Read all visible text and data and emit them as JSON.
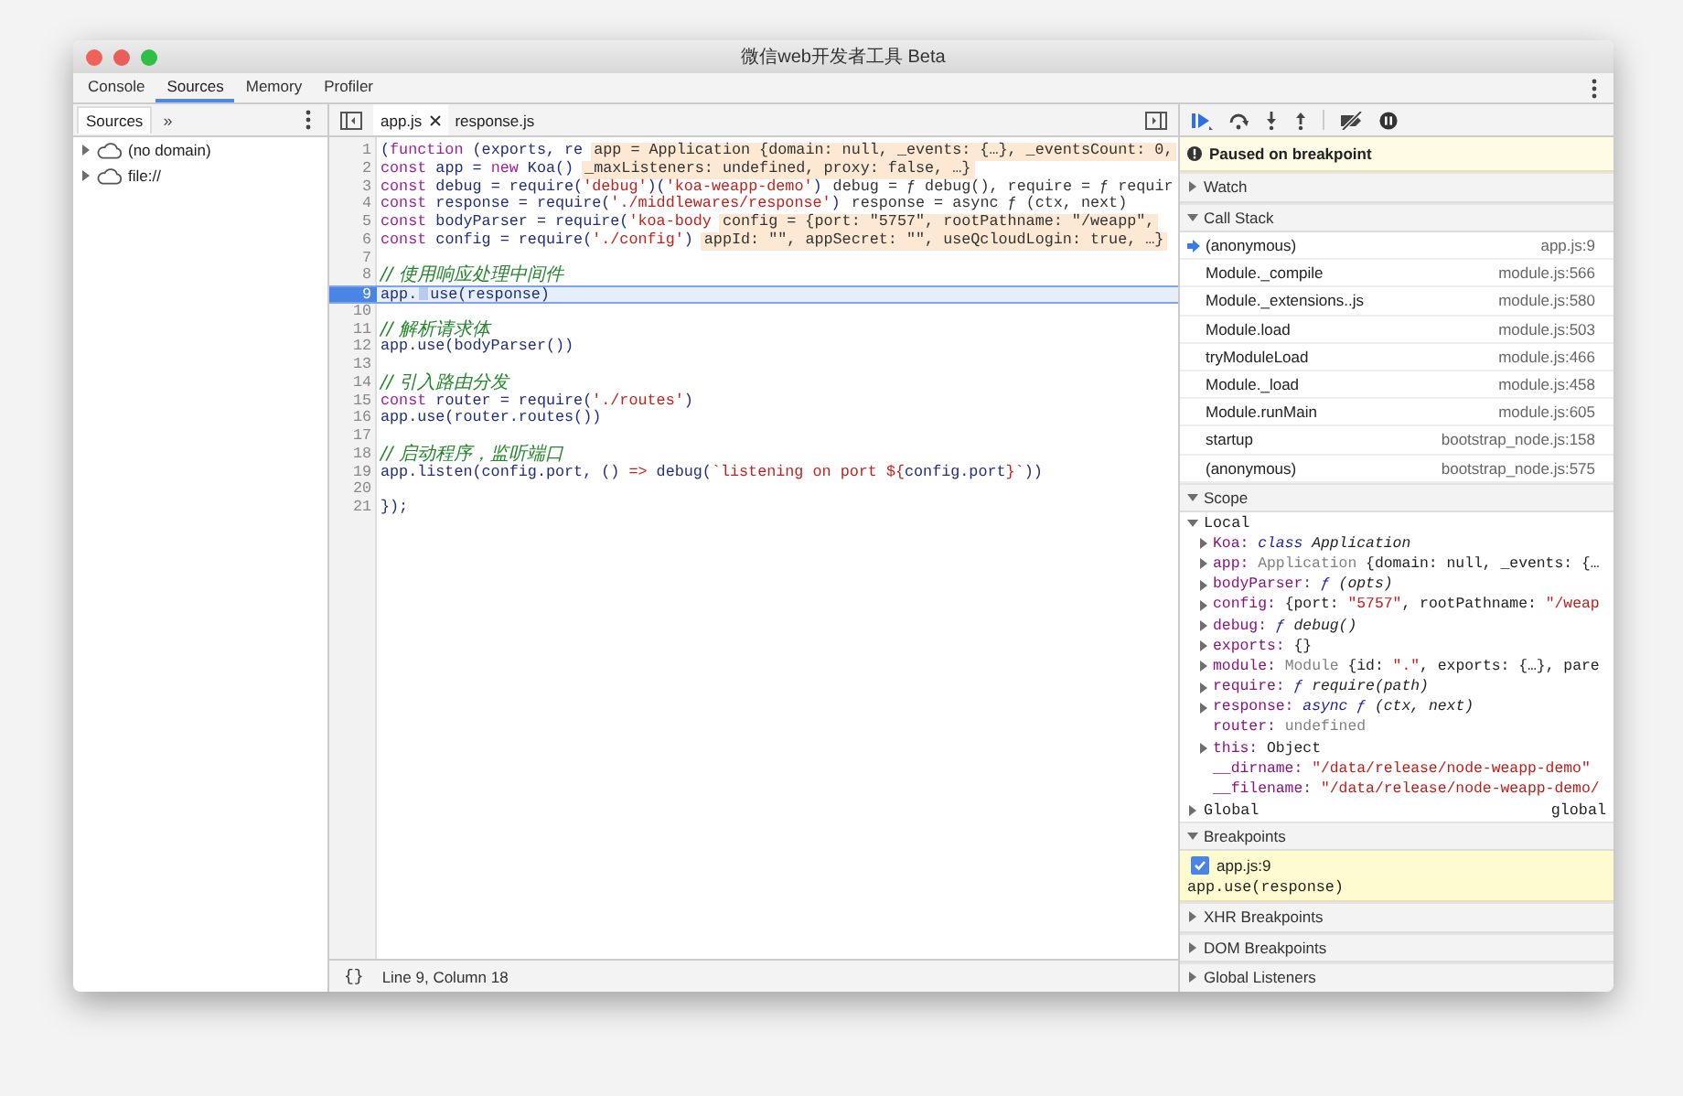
{
  "window": {
    "title": "微信web开发者工具 Beta"
  },
  "tabs": [
    {
      "label": "Console",
      "selected": false
    },
    {
      "label": "Sources",
      "selected": true
    },
    {
      "label": "Memory",
      "selected": false
    },
    {
      "label": "Profiler",
      "selected": false
    }
  ],
  "navigator": {
    "tabs": [
      {
        "label": "Sources",
        "selected": true
      }
    ],
    "more": "»",
    "tree": [
      {
        "label": "(no domain)",
        "expanded": false
      },
      {
        "label": "file://",
        "expanded": false
      }
    ]
  },
  "editor": {
    "tabs": [
      {
        "label": "app.js",
        "selected": true,
        "closable": true
      },
      {
        "label": "response.js",
        "selected": false,
        "closable": false
      }
    ],
    "lines": [
      {
        "number": "1",
        "breakpoint": false,
        "tokens": [
          {
            "kind": "code",
            "text": "("
          },
          {
            "kind": "kw",
            "text": "function"
          },
          {
            "kind": "code",
            "text": " (exports, re"
          }
        ],
        "inline_value": {
          "text": "app = Application {domain: null, _events: {…}, _eventsCount: 0,",
          "highlighted": true
        }
      },
      {
        "number": "2",
        "breakpoint": false,
        "tokens": [
          {
            "kind": "kw",
            "text": "const"
          },
          {
            "kind": "code",
            "text": " app = "
          },
          {
            "kind": "kw",
            "text": "new"
          },
          {
            "kind": "code",
            "text": " Koa()"
          }
        ],
        "inline_value": {
          "text": "_maxListeners: undefined, proxy: false, …}",
          "highlighted": true
        }
      },
      {
        "number": "3",
        "breakpoint": false,
        "tokens": [
          {
            "kind": "kw",
            "text": "const"
          },
          {
            "kind": "code",
            "text": " debug = require("
          },
          {
            "kind": "str",
            "text": "'debug'"
          },
          {
            "kind": "code",
            "text": ")("
          },
          {
            "kind": "str",
            "text": "'koa-weapp-demo'"
          },
          {
            "kind": "code",
            "text": ")"
          }
        ],
        "inline_value": {
          "text": "debug = ƒ debug(), require = ƒ requir",
          "highlighted": false
        }
      },
      {
        "number": "4",
        "breakpoint": false,
        "tokens": [
          {
            "kind": "kw",
            "text": "const"
          },
          {
            "kind": "code",
            "text": " response = require("
          },
          {
            "kind": "str",
            "text": "'./middlewares/response'"
          },
          {
            "kind": "code",
            "text": ")"
          }
        ],
        "inline_value": {
          "text": "response = async ƒ (ctx, next)",
          "highlighted": false
        }
      },
      {
        "number": "5",
        "breakpoint": false,
        "tokens": [
          {
            "kind": "kw",
            "text": "const"
          },
          {
            "kind": "code",
            "text": " bodyParser = require("
          },
          {
            "kind": "str",
            "text": "'koa-body"
          }
        ],
        "inline_value": {
          "text": "config = {port: \"5757\", rootPathname: \"/weapp\",",
          "highlighted": true
        }
      },
      {
        "number": "6",
        "breakpoint": false,
        "tokens": [
          {
            "kind": "kw",
            "text": "const"
          },
          {
            "kind": "code",
            "text": " config = require("
          },
          {
            "kind": "str",
            "text": "'./config'"
          },
          {
            "kind": "code",
            "text": ")"
          }
        ],
        "inline_value": {
          "text": "appId: \"\", appSecret: \"\", useQcloudLogin: true, …}",
          "highlighted": true
        }
      },
      {
        "number": "7",
        "breakpoint": false
      },
      {
        "number": "8",
        "breakpoint": false,
        "tokens": [
          {
            "kind": "cmt",
            "text": "// 使用响应处理中间件"
          }
        ]
      },
      {
        "number": "9",
        "breakpoint": true,
        "tokens": [
          {
            "kind": "code",
            "text": "app."
          },
          {
            "kind": "code",
            "text": "use(response)"
          }
        ]
      },
      {
        "number": "10",
        "breakpoint": false
      },
      {
        "number": "11",
        "breakpoint": false,
        "tokens": [
          {
            "kind": "cmt",
            "text": "// 解析请求体"
          }
        ]
      },
      {
        "number": "12",
        "breakpoint": false,
        "tokens": [
          {
            "kind": "code",
            "text": "app.use(bodyParser())"
          }
        ]
      },
      {
        "number": "13",
        "breakpoint": false
      },
      {
        "number": "14",
        "breakpoint": false,
        "tokens": [
          {
            "kind": "cmt",
            "text": "// 引入路由分发"
          }
        ]
      },
      {
        "number": "15",
        "breakpoint": false,
        "tokens": [
          {
            "kind": "kw",
            "text": "const"
          },
          {
            "kind": "code",
            "text": " router = require("
          },
          {
            "kind": "str",
            "text": "'./routes'"
          },
          {
            "kind": "code",
            "text": ")"
          }
        ]
      },
      {
        "number": "16",
        "breakpoint": false,
        "tokens": [
          {
            "kind": "code",
            "text": "app.use(router.routes())"
          }
        ]
      },
      {
        "number": "17",
        "breakpoint": false
      },
      {
        "number": "18",
        "breakpoint": false,
        "tokens": [
          {
            "kind": "cmt",
            "text": "// 启动程序，监听端口"
          }
        ]
      },
      {
        "number": "19",
        "breakpoint": false,
        "tokens": [
          {
            "kind": "code",
            "text": "app.listen(config.port, () "
          },
          {
            "kind": "str",
            "text": "=>"
          },
          {
            "kind": "code",
            "text": " debug("
          },
          {
            "kind": "str",
            "text": "`listening on port ${"
          },
          {
            "kind": "code",
            "text": "config.port"
          },
          {
            "kind": "str",
            "text": "}`"
          },
          {
            "kind": "code",
            "text": "))"
          }
        ]
      },
      {
        "number": "20",
        "breakpoint": false
      },
      {
        "number": "21",
        "breakpoint": false,
        "tokens": [
          {
            "kind": "code",
            "text": "});"
          }
        ]
      }
    ],
    "format_button": "{}",
    "status": "Line 9, Column 18"
  },
  "debugger": {
    "banner": "Paused on breakpoint",
    "sections": [
      {
        "kind": "plain",
        "title": "Watch",
        "expanded": false
      },
      {
        "kind": "call_stack",
        "title": "Call Stack",
        "expanded": true,
        "frames": [
          {
            "function": "(anonymous)",
            "location": "app.js:9",
            "selected": true
          },
          {
            "function": "Module._compile",
            "location": "module.js:566",
            "selected": false
          },
          {
            "function": "Module._extensions..js",
            "location": "module.js:580",
            "selected": false
          },
          {
            "function": "Module.load",
            "location": "module.js:503",
            "selected": false
          },
          {
            "function": "tryModuleLoad",
            "location": "module.js:466",
            "selected": false
          },
          {
            "function": "Module._load",
            "location": "module.js:458",
            "selected": false
          },
          {
            "function": "Module.runMain",
            "location": "module.js:605",
            "selected": false
          },
          {
            "function": "startup",
            "location": "bootstrap_node.js:158",
            "selected": false
          },
          {
            "function": "(anonymous)",
            "location": "bootstrap_node.js:575",
            "selected": false
          }
        ]
      },
      {
        "kind": "scope",
        "title": "Scope",
        "expanded": true,
        "scopes": [
          {
            "name": "Local",
            "expanded": true,
            "children": [
              {
                "name": "Koa:",
                "expandable": true,
                "value": [
                  {
                    "kind": "fn",
                    "text": "class"
                  },
                  {
                    "kind": "sig",
                    "text": " Application"
                  }
                ]
              },
              {
                "name": "app:",
                "expandable": true,
                "value": [
                  {
                    "kind": "dim",
                    "text": "Application"
                  },
                  {
                    "kind": "plain",
                    "text": " {domain: null, _events: {…"
                  }
                ]
              },
              {
                "name": "bodyParser:",
                "expandable": true,
                "value": [
                  {
                    "kind": "fn",
                    "text": "ƒ"
                  },
                  {
                    "kind": "sig",
                    "text": " (opts)"
                  }
                ]
              },
              {
                "name": "config:",
                "expandable": true,
                "value": [
                  {
                    "kind": "plain",
                    "text": "{port: "
                  },
                  {
                    "kind": "str",
                    "text": "\"5757\""
                  },
                  {
                    "kind": "plain",
                    "text": ", rootPathname: "
                  },
                  {
                    "kind": "str",
                    "text": "\"/weap"
                  }
                ]
              },
              {
                "name": "debug:",
                "expandable": true,
                "value": [
                  {
                    "kind": "fn",
                    "text": "ƒ"
                  },
                  {
                    "kind": "sig",
                    "text": " debug()"
                  }
                ]
              },
              {
                "name": "exports:",
                "expandable": true,
                "value": [
                  {
                    "kind": "plain",
                    "text": "{}"
                  }
                ]
              },
              {
                "name": "module:",
                "expandable": true,
                "value": [
                  {
                    "kind": "dim",
                    "text": "Module"
                  },
                  {
                    "kind": "plain",
                    "text": " {id: "
                  },
                  {
                    "kind": "str",
                    "text": "\".\""
                  },
                  {
                    "kind": "plain",
                    "text": ", exports: {…}, pare"
                  }
                ]
              },
              {
                "name": "require:",
                "expandable": true,
                "value": [
                  {
                    "kind": "fn",
                    "text": "ƒ"
                  },
                  {
                    "kind": "sig",
                    "text": " require(path)"
                  }
                ]
              },
              {
                "name": "response:",
                "expandable": true,
                "value": [
                  {
                    "kind": "fn",
                    "text": "async ƒ"
                  },
                  {
                    "kind": "sig",
                    "text": " (ctx, next)"
                  }
                ]
              },
              {
                "name": "router:",
                "expandable": false,
                "value": [
                  {
                    "kind": "dim",
                    "text": "undefined"
                  }
                ]
              },
              {
                "name": "this:",
                "expandable": true,
                "value": [
                  {
                    "kind": "plain",
                    "text": "Object"
                  }
                ]
              },
              {
                "name": "__dirname:",
                "expandable": false,
                "value": [
                  {
                    "kind": "str",
                    "text": "\"/data/release/node-weapp-demo\""
                  }
                ]
              },
              {
                "name": "__filename:",
                "expandable": false,
                "value": [
                  {
                    "kind": "str",
                    "text": "\"/data/release/node-weapp-demo/"
                  }
                ]
              }
            ]
          },
          {
            "name": "Global",
            "expanded": false,
            "value": "global"
          }
        ]
      },
      {
        "kind": "breakpoints",
        "title": "Breakpoints",
        "expanded": true,
        "items": [
          {
            "label": "app.js:9",
            "checked": true,
            "code": "app.use(response)"
          }
        ]
      },
      {
        "kind": "plain",
        "title": "XHR Breakpoints",
        "expanded": false
      },
      {
        "kind": "plain",
        "title": "DOM Breakpoints",
        "expanded": false
      },
      {
        "kind": "plain",
        "title": "Global Listeners",
        "expanded": false
      }
    ]
  }
}
